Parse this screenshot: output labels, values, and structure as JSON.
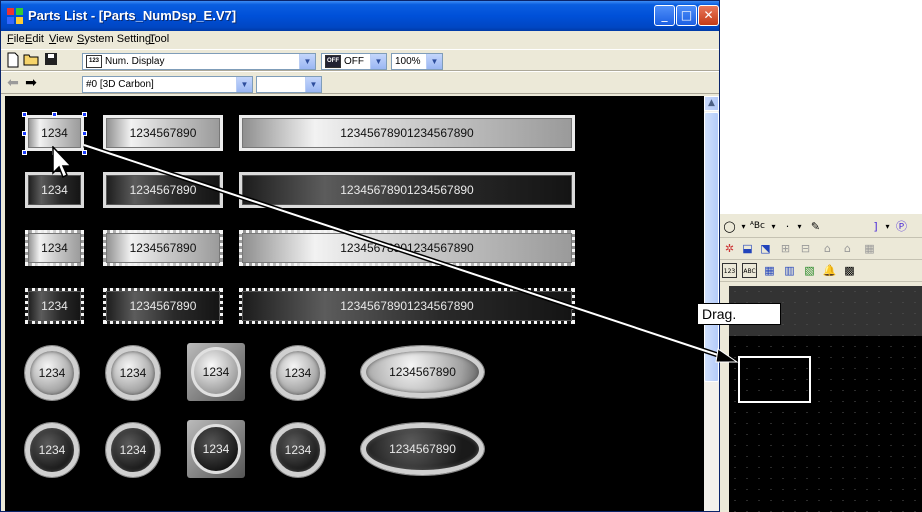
{
  "window": {
    "title": "Parts List - [Parts_NumDsp_E.V7]",
    "controls": {
      "minimize": "_",
      "maximize": "□",
      "close": "✕"
    }
  },
  "menu": [
    "File",
    "Edit",
    "View",
    "System Setting",
    "Tool"
  ],
  "toolbar1": {
    "parts_type": "Num. Display",
    "parts_type_badge": "123",
    "state_badge": "OFF",
    "state": "OFF",
    "zoom": "100%"
  },
  "toolbar2": {
    "style": "#0 [3D Carbon]",
    "extra": ""
  },
  "parts": {
    "rect": [
      [
        "1234",
        "1234567890",
        "12345678901234567890"
      ],
      [
        "1234",
        "1234567890",
        "12345678901234567890"
      ],
      [
        "1234",
        "1234567890",
        "12345678901234567890"
      ],
      [
        "1234",
        "1234567890",
        "12345678901234567890"
      ]
    ],
    "round_light": [
      "1234",
      "1234",
      "1234",
      "1234",
      "1234567890"
    ],
    "round_dark": [
      "1234",
      "1234",
      "1234",
      "1234",
      "1234567890"
    ]
  },
  "annotation": {
    "drag_label": "Drag."
  },
  "right_toolbar": {
    "row1": [
      "◯",
      "▾",
      "ᴬBc",
      "▾",
      "·",
      "▾",
      "✎",
      "]",
      "▾",
      "Ⓟ"
    ],
    "row2": [
      "✲",
      "⬓",
      "⬔",
      "⊞",
      "⊟",
      "⌂",
      "⌂",
      "▦"
    ],
    "row3": [
      "123",
      "ABC",
      "▦",
      "▥",
      "▧",
      "🔔",
      "▩"
    ]
  },
  "colors": {
    "title_bar": "#0050d8",
    "canvas": "#000000",
    "selection": "#1a3cff"
  }
}
